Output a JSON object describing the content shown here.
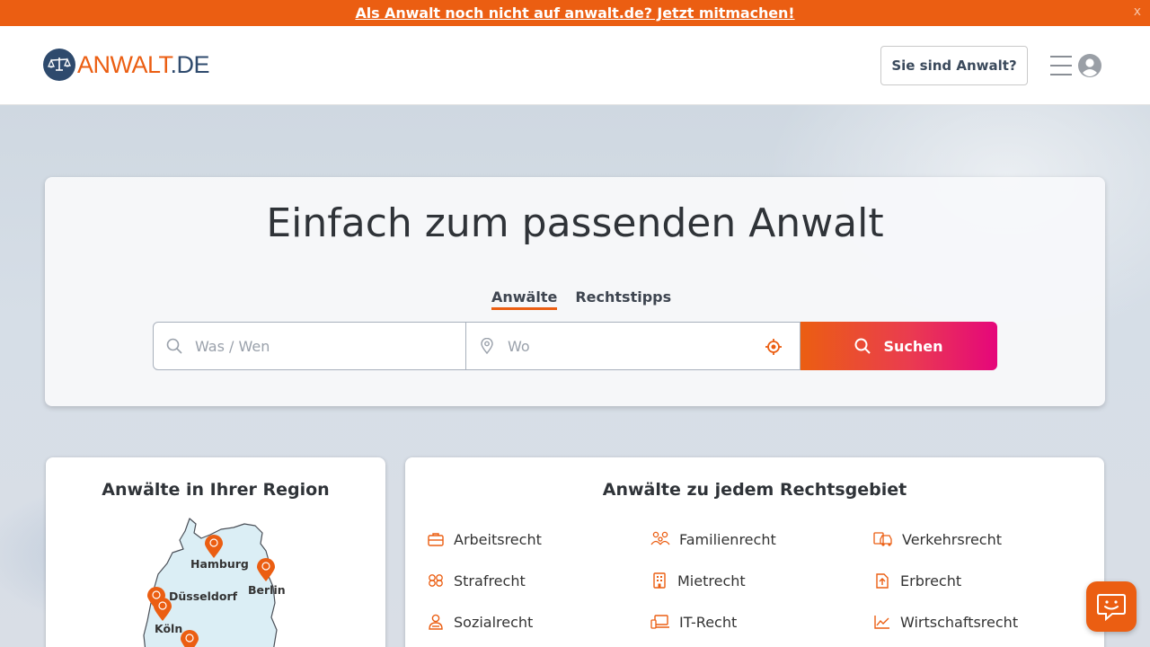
{
  "banner": {
    "link_text": "Als Anwalt noch nicht auf anwalt.de? Jetzt mitmachen!",
    "close_label": "x"
  },
  "header": {
    "logo_part1": "ANWALT",
    "logo_part2": ".DE",
    "lawyer_button": "Sie sind Anwalt?"
  },
  "hero": {
    "title": "Einfach zum passenden Anwalt",
    "tabs": [
      {
        "label": "Anwälte",
        "active": true
      },
      {
        "label": "Rechtstipps",
        "active": false
      }
    ],
    "what_placeholder": "Was / Wen",
    "where_placeholder": "Wo",
    "search_button": "Suchen"
  },
  "region_card": {
    "title": "Anwälte in Ihrer Region",
    "cities": [
      "Hamburg",
      "Berlin",
      "Düsseldorf",
      "Köln"
    ]
  },
  "area_card": {
    "title": "Anwälte zu jedem Rechtsgebiet",
    "items": [
      {
        "label": "Arbeitsrecht",
        "icon": "briefcase-icon"
      },
      {
        "label": "Familienrecht",
        "icon": "family-icon"
      },
      {
        "label": "Verkehrsrecht",
        "icon": "car-icon"
      },
      {
        "label": "Strafrecht",
        "icon": "handcuffs-icon"
      },
      {
        "label": "Mietrecht",
        "icon": "building-icon"
      },
      {
        "label": "Erbrecht",
        "icon": "inheritance-document-icon"
      },
      {
        "label": "Sozialrecht",
        "icon": "person-icon"
      },
      {
        "label": "IT-Recht",
        "icon": "laptop-icon"
      },
      {
        "label": "Wirtschaftsrecht",
        "icon": "chart-icon"
      }
    ]
  },
  "colors": {
    "accent": "#eb5e12",
    "navy": "#2e4a6d",
    "gradient_end": "#e5067b"
  }
}
